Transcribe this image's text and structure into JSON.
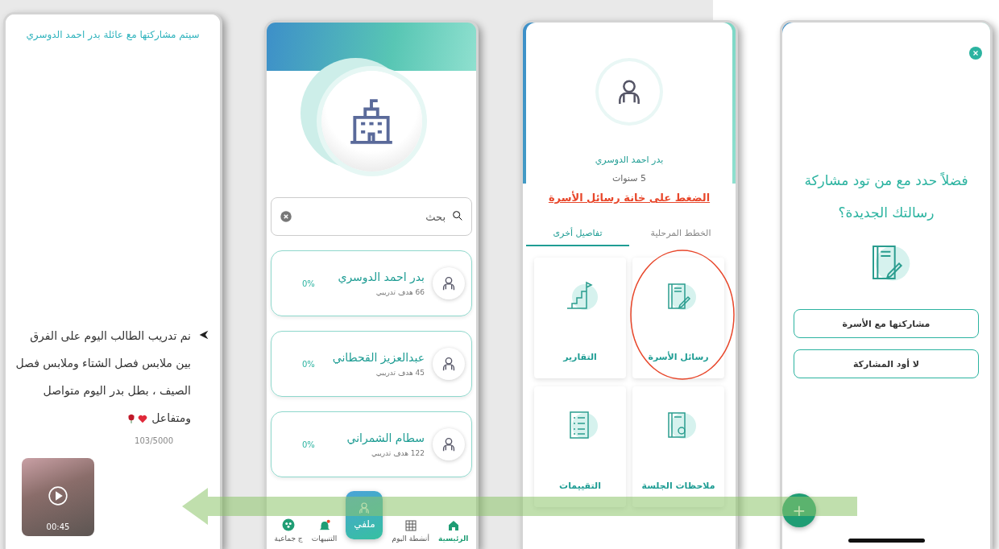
{
  "share_screen": {
    "header": "سيتم مشاركتها مع عائلة بدر احمد الدوسري",
    "message": "نم تدريب الطالب اليوم على الفرق بين ملابس فصل الشتاء وملابس فصل الصيف ، بطل بدر اليوم متواصل ومتفاعل",
    "counter": "103/5000",
    "video": {
      "duration": "00:45"
    }
  },
  "students_screen": {
    "search": {
      "placeholder": "بحث"
    },
    "students": [
      {
        "name": "بدر احمد الدوسري",
        "goals": "66 هدف تدريبي",
        "progress": "0%"
      },
      {
        "name": "عبدالعزيز القحطاني",
        "goals": "45 هدف تدريبي",
        "progress": "0%"
      },
      {
        "name": "سطام الشمراني",
        "goals": "122 هدف تدريبي",
        "progress": "0%"
      }
    ],
    "nav": [
      {
        "kind": "home",
        "label": "الرئيسية",
        "selected": true
      },
      {
        "kind": "grid",
        "label": "أنشطة اليوم",
        "selected": false
      },
      {
        "kind": "profile",
        "label": "ملفي",
        "selected": false
      },
      {
        "kind": "bell",
        "label": "التنبيهات",
        "selected": false
      },
      {
        "kind": "group",
        "label": "ج جماعية",
        "selected": false
      }
    ]
  },
  "profile_screen": {
    "name": "بدر احمد الدوسري",
    "age": "5 سنوات",
    "annotation": "الضغط على خانة رسائل الأسرة",
    "tabs": [
      {
        "label": "الخطط المرحلية",
        "selected": false
      },
      {
        "label": "تفاصيل أخرى",
        "selected": true
      }
    ],
    "tiles": [
      {
        "kind": "notebook",
        "label": "رسائل الأسرة",
        "circled": true
      },
      {
        "kind": "chart",
        "label": "التقارير",
        "circled": false
      },
      {
        "kind": "notes",
        "label": "ملاحظات الجلسة",
        "circled": false
      },
      {
        "kind": "list",
        "label": "التقييمات",
        "circled": false
      }
    ]
  },
  "share_dialog": {
    "prompt": "فضلاً حدد مع من تود مشاركة رسالتك الجديدة؟",
    "options": [
      "مشاركتها مع الأسرة",
      "لا أود المشاركة"
    ],
    "fab": "+"
  }
}
